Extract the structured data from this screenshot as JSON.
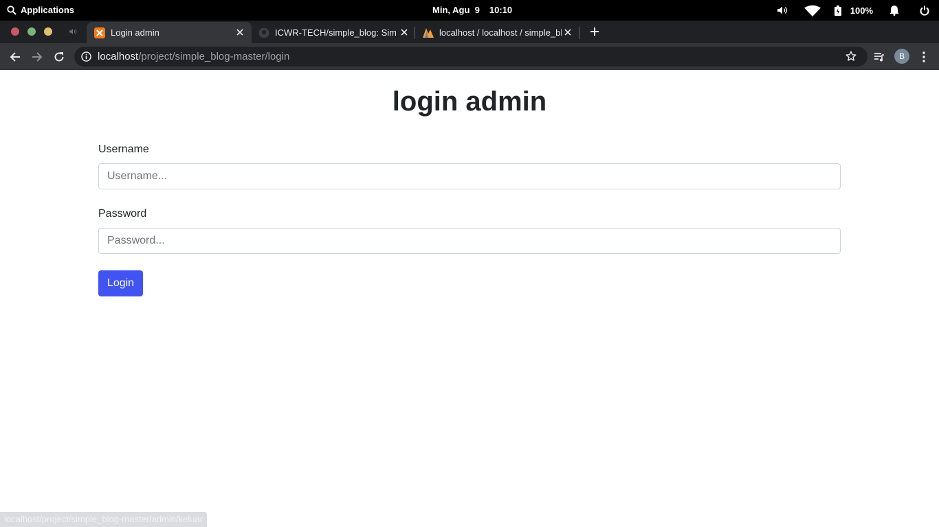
{
  "system_bar": {
    "applications_label": "Applications",
    "date": "Min, Agu  9",
    "time": "10:10",
    "battery": "100%"
  },
  "tabs": [
    {
      "title": "Login admin",
      "active": true,
      "favicon": "xampp-icon"
    },
    {
      "title": "ICWR-TECH/simple_blog: Simple",
      "active": false,
      "favicon": "github-icon"
    },
    {
      "title": "localhost / localhost / simple_blo",
      "active": false,
      "favicon": "phpmyadmin-icon"
    }
  ],
  "address_bar": {
    "host": "localhost",
    "path": "/project/simple_blog-master/login"
  },
  "profile": {
    "initial": "B"
  },
  "page": {
    "title": "login admin",
    "username_label": "Username",
    "username_placeholder": "Username...",
    "password_label": "Password",
    "password_placeholder": "Password...",
    "login_button": "Login"
  },
  "status_bar": {
    "url": "localhost/project/simple_blog-master/admin/keluar"
  },
  "colors": {
    "primary_button": "#4154f1",
    "tab_strip": "#202124",
    "toolbar": "#35363a"
  }
}
